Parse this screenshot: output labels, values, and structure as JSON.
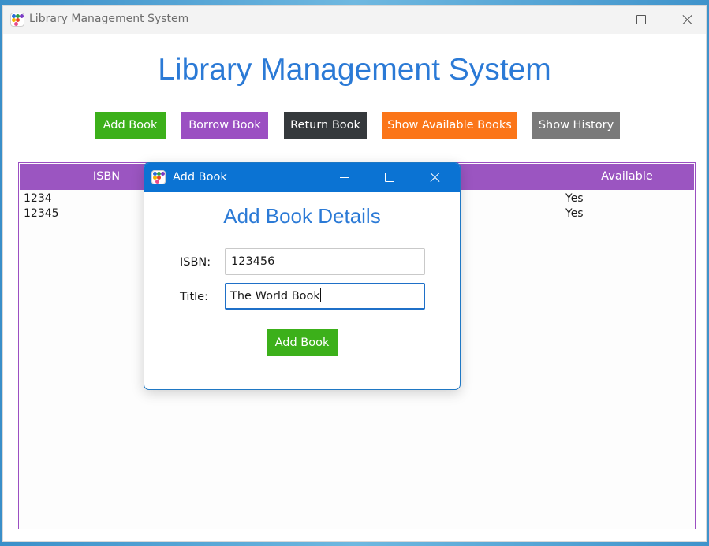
{
  "main_window": {
    "title": "Library Management System",
    "heading": "Library Management System",
    "icon": "app-dots-icon"
  },
  "toolbar": {
    "add_book": "Add Book",
    "borrow_book": "Borrow Book",
    "return_book": "Return Book",
    "show_available": "Show Available Books",
    "show_history": "Show History"
  },
  "colors": {
    "heading": "#2b7ad6",
    "add": "#3cb01a",
    "borrow": "#9b4fc2",
    "return": "#35393c",
    "available": "#fb7518",
    "history": "#7a7a7a",
    "dialog_titlebar": "#0b73d3"
  },
  "table": {
    "headers": {
      "isbn": "ISBN",
      "available": "Available"
    },
    "rows": [
      {
        "isbn": "1234",
        "available": "Yes"
      },
      {
        "isbn": "12345",
        "available": "Yes"
      }
    ]
  },
  "dialog": {
    "title": "Add Book",
    "heading": "Add Book Details",
    "isbn_label": "ISBN:",
    "isbn_value": "123456",
    "title_label": "Title:",
    "title_value": "The World Book",
    "submit": "Add Book"
  }
}
